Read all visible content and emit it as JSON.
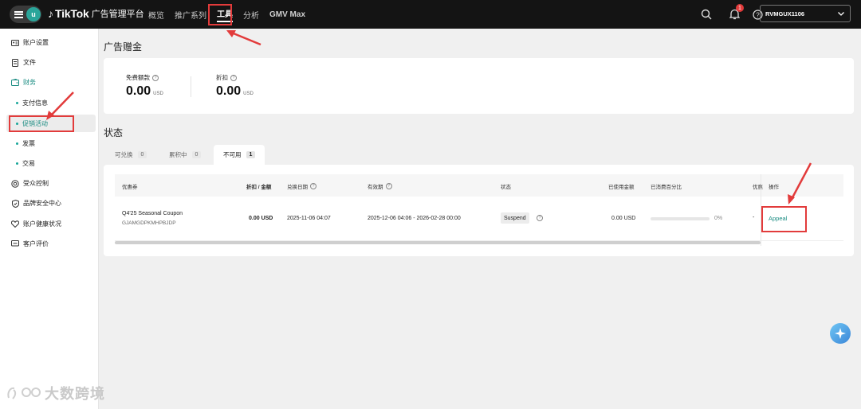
{
  "topbar": {
    "avatar_letter": "u",
    "brand": "TikTok",
    "brand_sub": "广告管理平台",
    "nav": [
      "概览",
      "推广系列",
      "工具",
      "分析",
      "GMV Max"
    ],
    "notification_count": "1",
    "account_name": "RVMGUX1106"
  },
  "sidebar": {
    "account_settings": "账户设置",
    "files": "文件",
    "finance": "财务",
    "payment_info": "支付信息",
    "promotions": "促销活动",
    "invoices": "发票",
    "transactions": "交易",
    "audience_control": "受众控制",
    "brand_safety": "品牌安全中心",
    "account_health": "账户健康状况",
    "customer_reviews": "客户评价"
  },
  "credits": {
    "title": "广告赠金",
    "free_credit_label": "免费额款",
    "free_credit_value": "0.00",
    "free_credit_unit": "USD",
    "discount_label": "折扣",
    "discount_value": "0.00",
    "discount_unit": "USD"
  },
  "status": {
    "title": "状态",
    "tabs": [
      {
        "label": "可兑换",
        "count": "0"
      },
      {
        "label": "累积中",
        "count": "0"
      },
      {
        "label": "不可用",
        "count": "1"
      }
    ],
    "active_tab": 2
  },
  "table": {
    "headers": {
      "coupon": "优惠券",
      "discount_amount": "折扣 / 金额",
      "redeem_date": "兑换日期",
      "validity": "有效期",
      "status": "状态",
      "used_amount": "已使用金额",
      "consumed_pct": "已消费百分比",
      "truncated": "优惠",
      "action": "操作"
    },
    "rows": [
      {
        "coupon_name": "Q4'25 Seasonal Coupon",
        "coupon_code": "GJAMGDPKMHPBJDP",
        "discount_amount": "0.00 USD",
        "redeem_date": "2025-11-06 04:07",
        "validity": "2025-12-06 04:06 - 2026-02-28 00:00",
        "status": "Suspend",
        "used_amount": "0.00 USD",
        "consumed_pct_value": 0,
        "consumed_pct_text": "0%",
        "truncated_value": "-",
        "action": "Appeal"
      }
    ]
  },
  "watermark": "大数跨境",
  "colors": {
    "accent": "#1a8c82",
    "highlight": "#e23b3b",
    "topbar": "#141414"
  }
}
